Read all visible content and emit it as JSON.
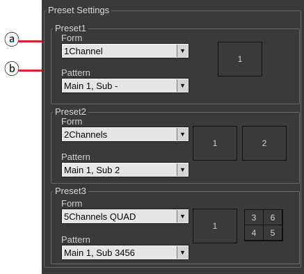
{
  "settings": {
    "title": "Preset Settings",
    "form_label": "Form",
    "pattern_label": "Pattern",
    "dropdown_arrow": "▼",
    "presets": [
      {
        "title": "Preset1",
        "form": "1Channel",
        "pattern": "Main 1, Sub -",
        "layout": [
          "1"
        ]
      },
      {
        "title": "Preset2",
        "form": "2Channels",
        "pattern": "Main 1, Sub 2",
        "layout": [
          "1",
          "2"
        ]
      },
      {
        "title": "Preset3",
        "form": "5Channels QUAD",
        "pattern": "Main 1, Sub 3456",
        "layout": [
          "1"
        ],
        "quad": [
          "3",
          "6",
          "4",
          "5"
        ]
      }
    ]
  },
  "callouts": {
    "a": "ⓐ",
    "b": "ⓑ",
    "line_color": "#e0202a"
  }
}
